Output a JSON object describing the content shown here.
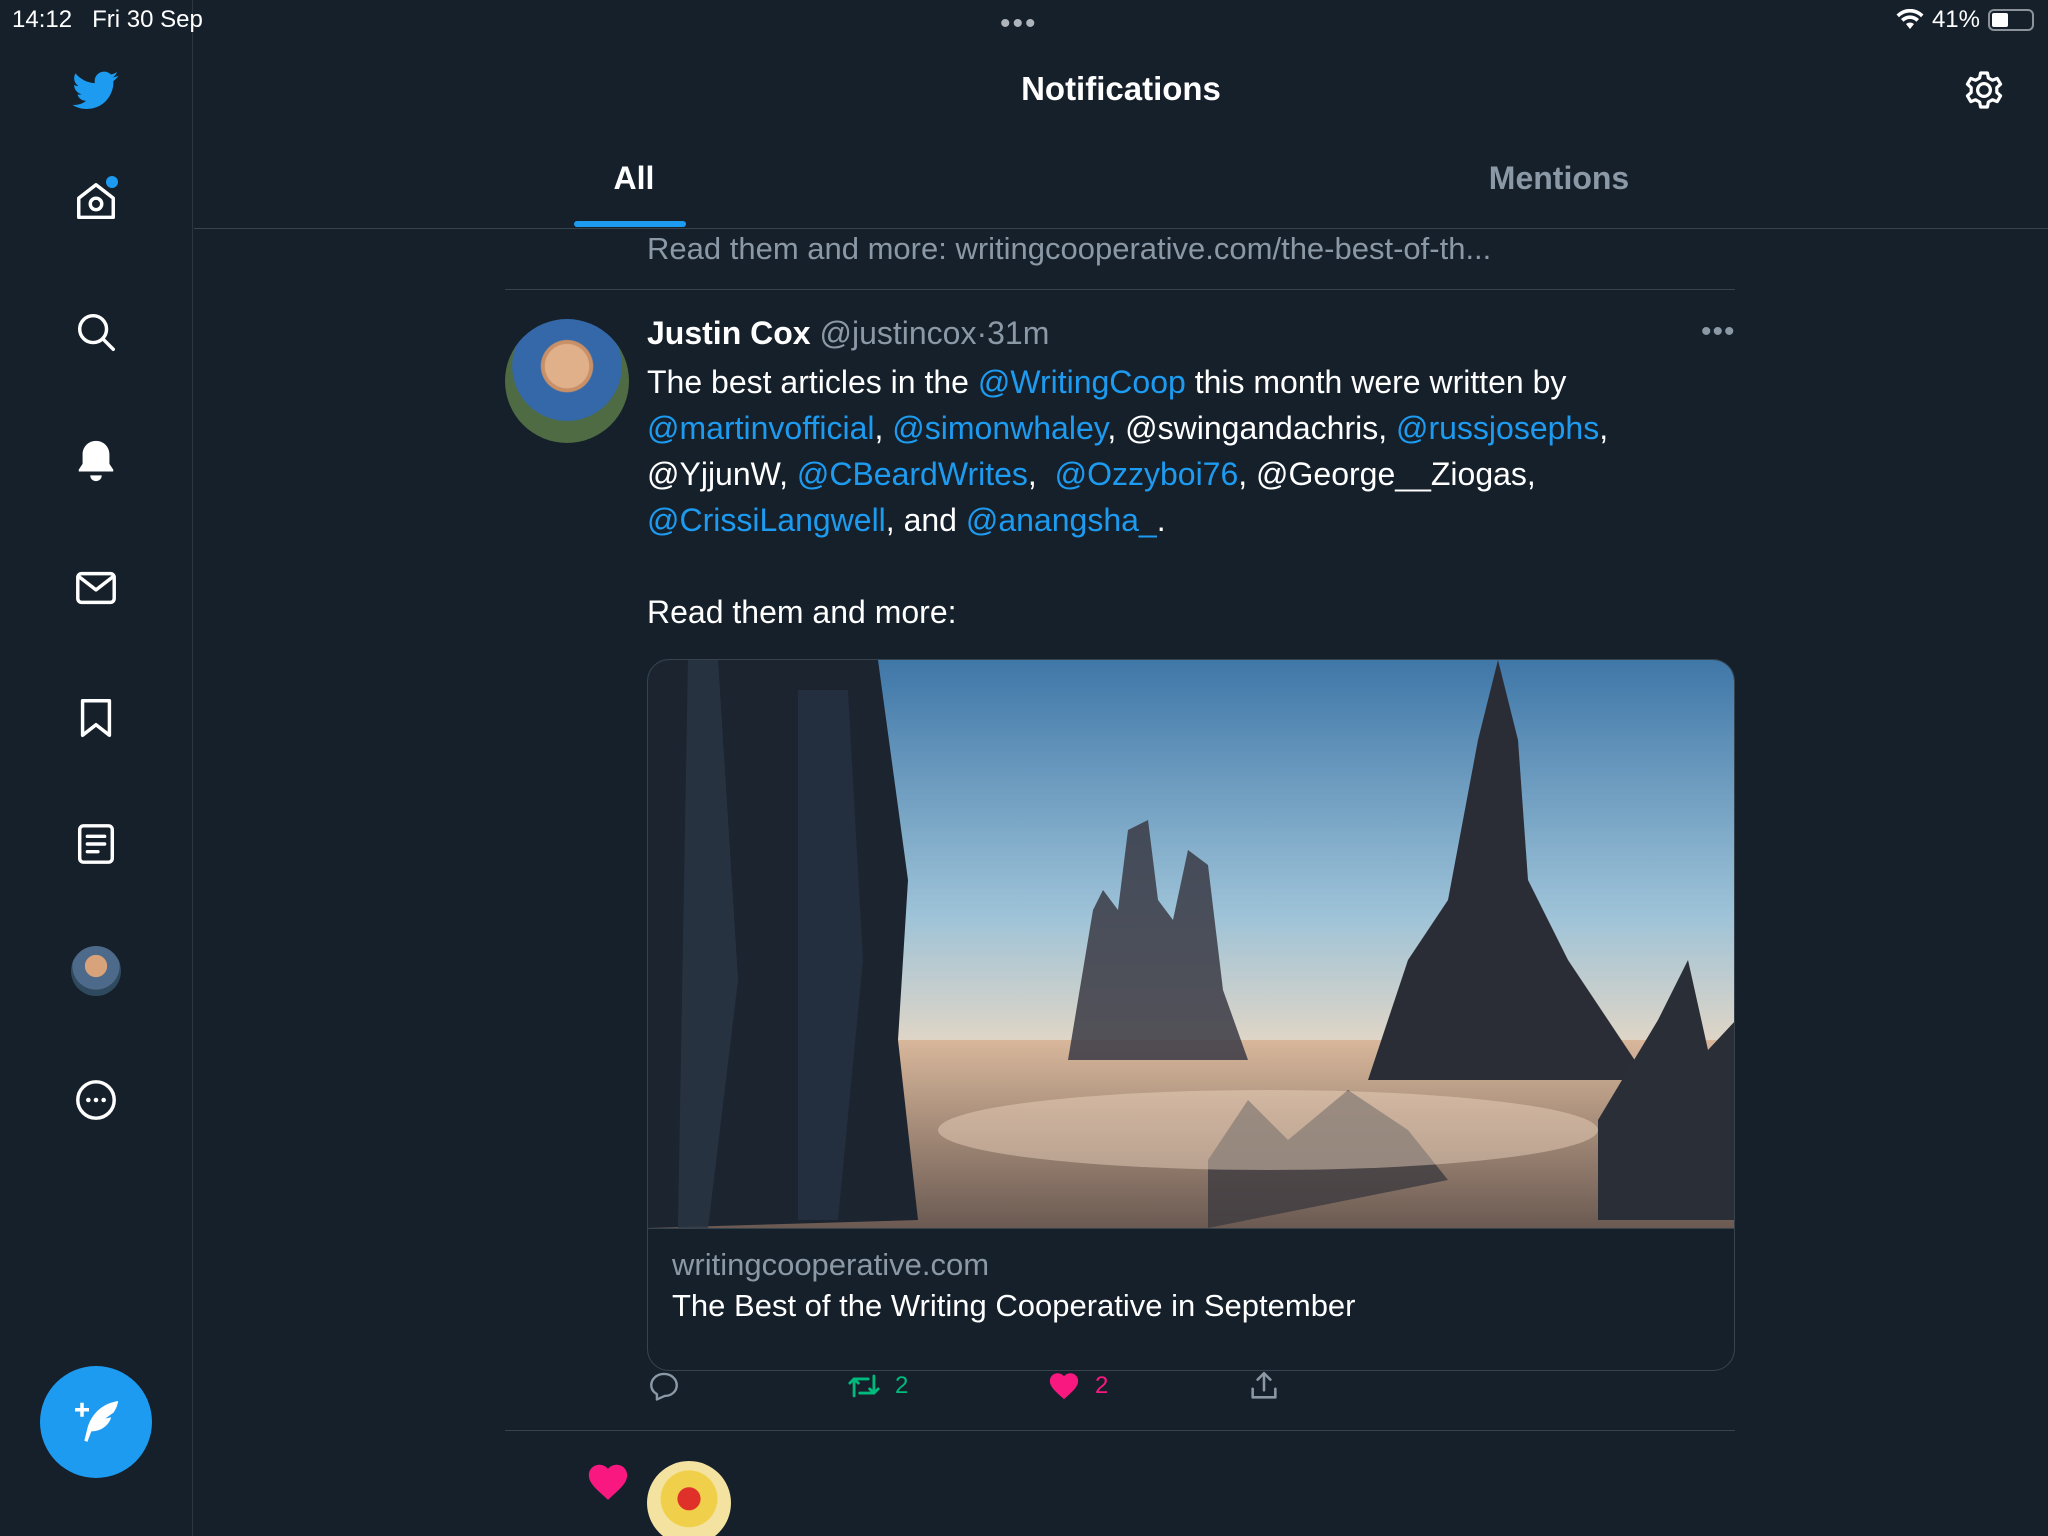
{
  "status_bar": {
    "time": "14:12",
    "date": "Fri 30 Sep",
    "multitask": "•••",
    "battery_text": "41%",
    "battery_level": 0.41
  },
  "sidebar": {
    "items": [
      {
        "name": "twitter-logo-icon"
      },
      {
        "name": "home-icon",
        "badge": true
      },
      {
        "name": "search-icon"
      },
      {
        "name": "notifications-icon"
      },
      {
        "name": "messages-icon"
      },
      {
        "name": "bookmarks-icon"
      },
      {
        "name": "lists-icon"
      },
      {
        "name": "profile-avatar"
      },
      {
        "name": "more-icon"
      }
    ],
    "compose_icon": "compose-tweet-icon"
  },
  "header": {
    "title": "Notifications",
    "tabs": [
      {
        "label": "All",
        "active": true
      },
      {
        "label": "Mentions",
        "active": false
      }
    ]
  },
  "feed": {
    "previous_tweet_tail": "Read them and more: writingcooperative.com/the-best-of-th...",
    "tweet": {
      "name": "Justin Cox",
      "handle": "@justincox",
      "separator": "·",
      "time": "31m",
      "more": "•••",
      "body": {
        "p1": "The best articles in the ",
        "m1": "@WritingCoop",
        "p2": " this month were written by ",
        "m2": "@martinvofficial",
        "p3": ", ",
        "m3": "@simonwhaley",
        "p4": ", @swingandachris, ",
        "m4": "@russjosephs",
        "p5": ", @YjjunW, ",
        "m5": "@CBeardWrites",
        "p6": ",  ",
        "m6": "@Ozzyboi76",
        "p7": ", @George__Ziogas, ",
        "m7": "@CrissiLangwell",
        "p8": ", and ",
        "m8": "@anangsha_",
        "p9": "."
      },
      "read_more": "Read them and more:",
      "card": {
        "domain": "writingcooperative.com",
        "title": "The Best of the Writing Cooperative in September"
      },
      "actions": {
        "retweets": "2",
        "likes": "2"
      }
    }
  },
  "colors": {
    "background": "#15202b",
    "accent": "#1d9bf0",
    "retweet": "#00ba7c",
    "like": "#f91880",
    "muted": "#8b98a5"
  }
}
